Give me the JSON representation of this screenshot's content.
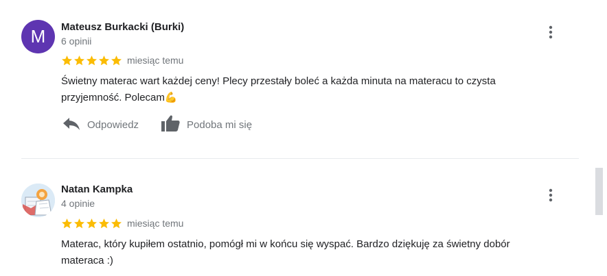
{
  "reviews": [
    {
      "avatar_letter": "M",
      "avatar_color": "#5e35b1",
      "name": "Mateusz Burkacki (Burki)",
      "review_count": "6 opinii",
      "rating": 5,
      "date": "miesiąc temu",
      "text": "Świetny materac wart każdej ceny! Plecy przestały boleć a każda minuta na materacu to czysta przyjemność. Polecam💪",
      "reply_label": "Odpowiedz",
      "like_label": "Podoba mi się"
    },
    {
      "avatar_icon": "profile-illustration",
      "name": "Natan Kampka",
      "review_count": "4 opinie",
      "rating": 5,
      "date": "miesiąc temu",
      "text": "Materac, który kupiłem ostatnio, pomógł mi w końcu się wyspać. Bardzo dziękuję za świetny dobór materaca :)"
    }
  ],
  "colors": {
    "star": "#fbbc04",
    "secondary_text": "#70757a",
    "icon": "#5f6368"
  }
}
